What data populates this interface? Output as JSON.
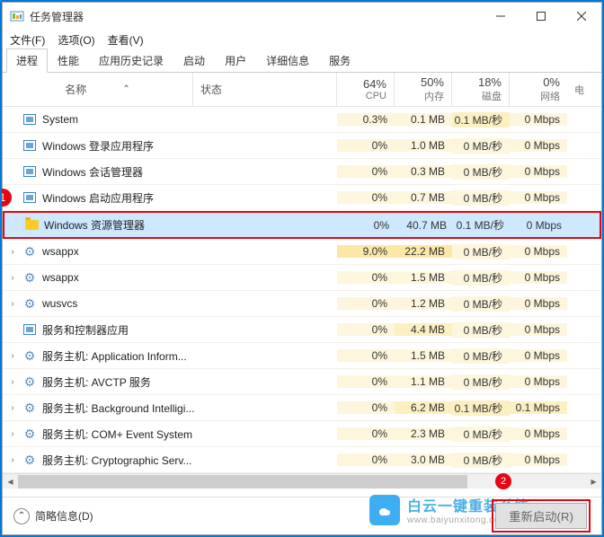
{
  "window": {
    "title": "任务管理器"
  },
  "menu": {
    "file": "文件(F)",
    "options": "选项(O)",
    "view": "查看(V)"
  },
  "tabs": [
    "进程",
    "性能",
    "应用历史记录",
    "启动",
    "用户",
    "详细信息",
    "服务"
  ],
  "columns": {
    "name": "名称",
    "status": "状态",
    "cpu_pct": "64%",
    "cpu": "CPU",
    "mem_pct": "50%",
    "mem": "内存",
    "disk_pct": "18%",
    "disk": "磁盘",
    "net_pct": "0%",
    "net": "网络",
    "extra": "电"
  },
  "rows": [
    {
      "icon": "sys",
      "name": "System",
      "cpu": "0.3%",
      "mem": "0.1 MB",
      "disk": "0.1 MB/秒",
      "net": "0 Mbps",
      "exp": false
    },
    {
      "icon": "sys",
      "name": "Windows 登录应用程序",
      "cpu": "0%",
      "mem": "1.0 MB",
      "disk": "0 MB/秒",
      "net": "0 Mbps",
      "exp": false
    },
    {
      "icon": "sys",
      "name": "Windows 会话管理器",
      "cpu": "0%",
      "mem": "0.3 MB",
      "disk": "0 MB/秒",
      "net": "0 Mbps",
      "exp": false
    },
    {
      "icon": "sys",
      "name": "Windows 启动应用程序",
      "cpu": "0%",
      "mem": "0.7 MB",
      "disk": "0 MB/秒",
      "net": "0 Mbps",
      "exp": false,
      "marker": 1
    },
    {
      "icon": "folder",
      "name": "Windows 资源管理器",
      "cpu": "0%",
      "mem": "40.7 MB",
      "disk": "0.1 MB/秒",
      "net": "0 Mbps",
      "exp": false,
      "selected": true
    },
    {
      "icon": "gear",
      "name": "wsappx",
      "cpu": "9.0%",
      "mem": "22.2 MB",
      "disk": "0 MB/秒",
      "net": "0 Mbps",
      "exp": true
    },
    {
      "icon": "gear",
      "name": "wsappx",
      "cpu": "0%",
      "mem": "1.5 MB",
      "disk": "0 MB/秒",
      "net": "0 Mbps",
      "exp": true
    },
    {
      "icon": "gear",
      "name": "wusvcs",
      "cpu": "0%",
      "mem": "1.2 MB",
      "disk": "0 MB/秒",
      "net": "0 Mbps",
      "exp": true
    },
    {
      "icon": "sys",
      "name": "服务和控制器应用",
      "cpu": "0%",
      "mem": "4.4 MB",
      "disk": "0 MB/秒",
      "net": "0 Mbps",
      "exp": false
    },
    {
      "icon": "gear",
      "name": "服务主机: Application Inform...",
      "cpu": "0%",
      "mem": "1.5 MB",
      "disk": "0 MB/秒",
      "net": "0 Mbps",
      "exp": true
    },
    {
      "icon": "gear",
      "name": "服务主机: AVCTP 服务",
      "cpu": "0%",
      "mem": "1.1 MB",
      "disk": "0 MB/秒",
      "net": "0 Mbps",
      "exp": true
    },
    {
      "icon": "gear",
      "name": "服务主机: Background Intelligi...",
      "cpu": "0%",
      "mem": "6.2 MB",
      "disk": "0.1 MB/秒",
      "net": "0.1 Mbps",
      "exp": true
    },
    {
      "icon": "gear",
      "name": "服务主机: COM+ Event System",
      "cpu": "0%",
      "mem": "2.3 MB",
      "disk": "0 MB/秒",
      "net": "0 Mbps",
      "exp": true
    },
    {
      "icon": "gear",
      "name": "服务主机: Cryptographic Serv...",
      "cpu": "0%",
      "mem": "3.0 MB",
      "disk": "0 MB/秒",
      "net": "0 Mbps",
      "exp": true
    }
  ],
  "footer": {
    "fewer": "简略信息(D)",
    "restart": "重新启动(R)"
  },
  "watermark": {
    "line1": "白云一键重装系统",
    "line2": "www.baiyunxitong.com"
  },
  "markers": {
    "m1": "1",
    "m2": "2"
  }
}
